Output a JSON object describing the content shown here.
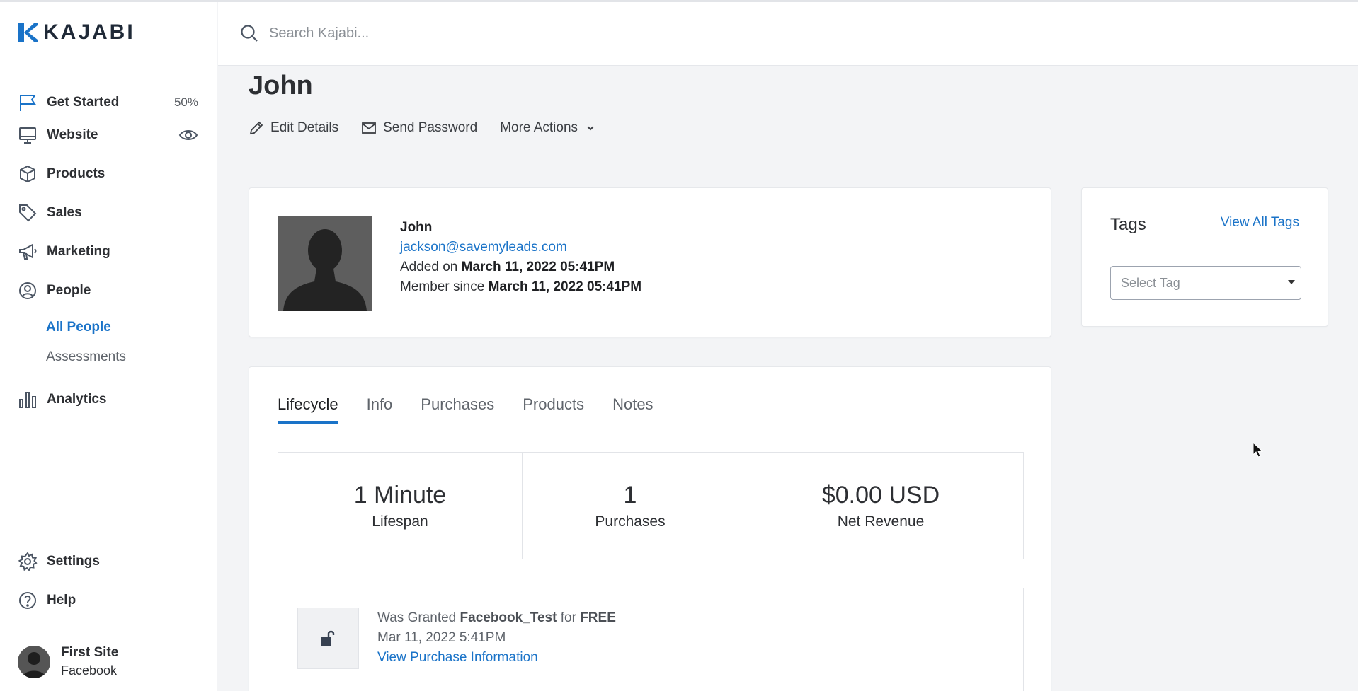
{
  "app": {
    "logo_text": "KAJABI",
    "brand_color": "#1a73c8"
  },
  "sidebar": {
    "items": [
      {
        "label": "Get Started",
        "icon": "flag-icon",
        "badge": "50%"
      },
      {
        "label": "Website",
        "icon": "monitor-icon",
        "right_icon": "eye-icon"
      },
      {
        "label": "Products",
        "icon": "box-icon"
      },
      {
        "label": "Sales",
        "icon": "tag-icon"
      },
      {
        "label": "Marketing",
        "icon": "megaphone-icon"
      },
      {
        "label": "People",
        "icon": "user-circle-icon",
        "subitems": [
          {
            "label": "All People",
            "active": true
          },
          {
            "label": "Assessments",
            "active": false
          }
        ]
      },
      {
        "label": "Analytics",
        "icon": "bar-chart-icon"
      }
    ],
    "bottom_items": [
      {
        "label": "Settings",
        "icon": "gear-icon"
      },
      {
        "label": "Help",
        "icon": "help-icon"
      }
    ],
    "site": {
      "name": "First Site",
      "subtitle": "Facebook"
    }
  },
  "search": {
    "placeholder": "Search Kajabi..."
  },
  "page": {
    "title": "John",
    "actions": {
      "edit": "Edit Details",
      "send_password": "Send Password",
      "more": "More Actions"
    }
  },
  "profile": {
    "name": "John",
    "email": "jackson@savemyleads.com",
    "added_prefix": "Added on",
    "added_date": "March 11, 2022 05:41PM",
    "member_prefix": "Member since",
    "member_date": "March 11, 2022 05:41PM"
  },
  "tags": {
    "title": "Tags",
    "view_all": "View All Tags",
    "select_placeholder": "Select Tag"
  },
  "tabs": [
    {
      "label": "Lifecycle",
      "active": true
    },
    {
      "label": "Info",
      "active": false
    },
    {
      "label": "Purchases",
      "active": false
    },
    {
      "label": "Products",
      "active": false
    },
    {
      "label": "Notes",
      "active": false
    }
  ],
  "stats": [
    {
      "value": "1 Minute",
      "label": "Lifespan"
    },
    {
      "value": "1",
      "label": "Purchases"
    },
    {
      "value": "$0.00 USD",
      "label": "Net Revenue"
    }
  ],
  "activity": {
    "prefix": "Was Granted",
    "product": "Facebook_Test",
    "middle": "for",
    "price": "FREE",
    "date": "Mar 11, 2022 5:41PM",
    "link": "View Purchase Information"
  }
}
